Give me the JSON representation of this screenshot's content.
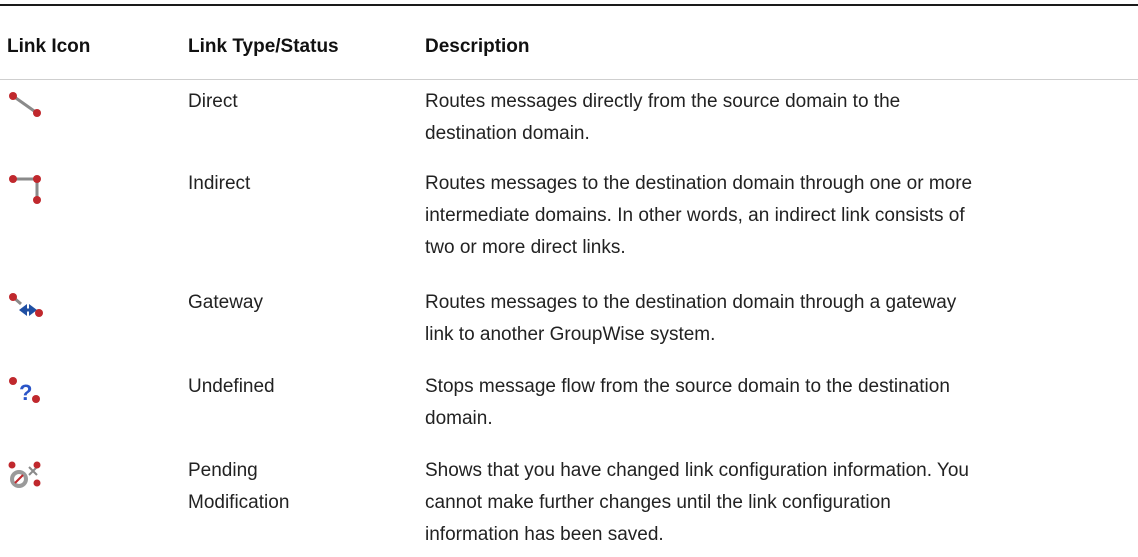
{
  "headers": {
    "icon": "Link Icon",
    "type": "Link Type/Status",
    "description": "Description"
  },
  "rows": [
    {
      "icon": "direct-link-icon",
      "type_lines": [
        "Direct"
      ],
      "description_lines": [
        "Routes messages directly from the source domain to the",
        "destination domain."
      ]
    },
    {
      "icon": "indirect-link-icon",
      "type_lines": [
        "Indirect"
      ],
      "description_lines": [
        "Routes messages to the destination domain through one or more",
        "intermediate domains. In other words, an indirect link consists of",
        "two or more direct links."
      ]
    },
    {
      "icon": "gateway-link-icon",
      "type_lines": [
        "Gateway"
      ],
      "description_lines": [
        "Routes messages to the destination domain through a gateway",
        "link to another GroupWise system."
      ]
    },
    {
      "icon": "undefined-link-icon",
      "type_lines": [
        "Undefined"
      ],
      "description_lines": [
        "Stops message flow from the source domain to the destination",
        "domain."
      ]
    },
    {
      "icon": "pending-modification-icon",
      "type_lines": [
        "Pending",
        "Modification"
      ],
      "description_lines": [
        "Shows that you have changed link configuration information. You",
        "cannot make further changes until the link configuration",
        "information has been saved."
      ]
    }
  ],
  "colors": {
    "node_red": "#c0282d",
    "link_gray": "#8a8a8a",
    "gateway_blue": "#1f4fa3",
    "question_blue": "#2a55c8"
  }
}
